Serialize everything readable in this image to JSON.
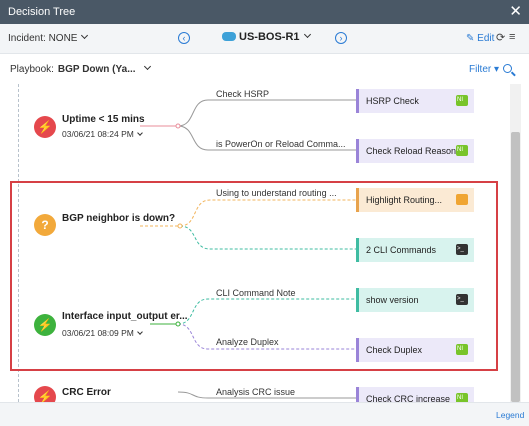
{
  "window": {
    "title": "Decision Tree",
    "close_glyph": "✕"
  },
  "toolbar": {
    "incident_label": "Incident: NONE",
    "device": "US-BOS-R1",
    "prev_glyph": "‹",
    "next_glyph": "›",
    "edit_label": "✎ Edit",
    "refresh_glyph": "⟳",
    "menu_glyph": "≡"
  },
  "playbook": {
    "label": "Playbook:",
    "value": "BGP Down (Ya..."
  },
  "filter_label": "Filter ▾",
  "nodes": [
    {
      "title": "Uptime < 15 mins",
      "date": "03/06/21 08:24 PM",
      "icon": "red-warning-icon",
      "glyph": "⚡"
    },
    {
      "title": "BGP neighbor is down?",
      "date": "",
      "icon": "question-icon",
      "glyph": "?"
    },
    {
      "title": "Interface input_output er...",
      "date": "03/06/21 08:09 PM",
      "icon": "green-warning-icon",
      "glyph": "⚡"
    },
    {
      "title": "CRC Error",
      "date": "",
      "icon": "red-warning-icon",
      "glyph": "⚡"
    }
  ],
  "edges": [
    "Check HSRP",
    "is PowerOn or Reload Comma...",
    "Using to understand routing ...",
    "CLI Command Note",
    "Analyze Duplex",
    "Analysis CRC issue"
  ],
  "actions": [
    {
      "label": "HSRP Check",
      "type": "ni"
    },
    {
      "label": "Check Reload Reason",
      "type": "ni"
    },
    {
      "label": "Highlight Routing...",
      "type": "note"
    },
    {
      "label": "2 CLI Commands",
      "type": "cli"
    },
    {
      "label": "show version",
      "type": "cli"
    },
    {
      "label": "Check Duplex",
      "type": "ni"
    },
    {
      "label": "Check CRC increase",
      "type": "ni"
    }
  ],
  "footer": {
    "legend_label": "Legend"
  },
  "colors": {
    "titlebar": "#4a5866",
    "accent": "#2a7bd4",
    "highlight": "#d64045",
    "warn_red": "#e5484d",
    "question_yellow": "#f2a93b",
    "ok_green": "#3db23d"
  }
}
